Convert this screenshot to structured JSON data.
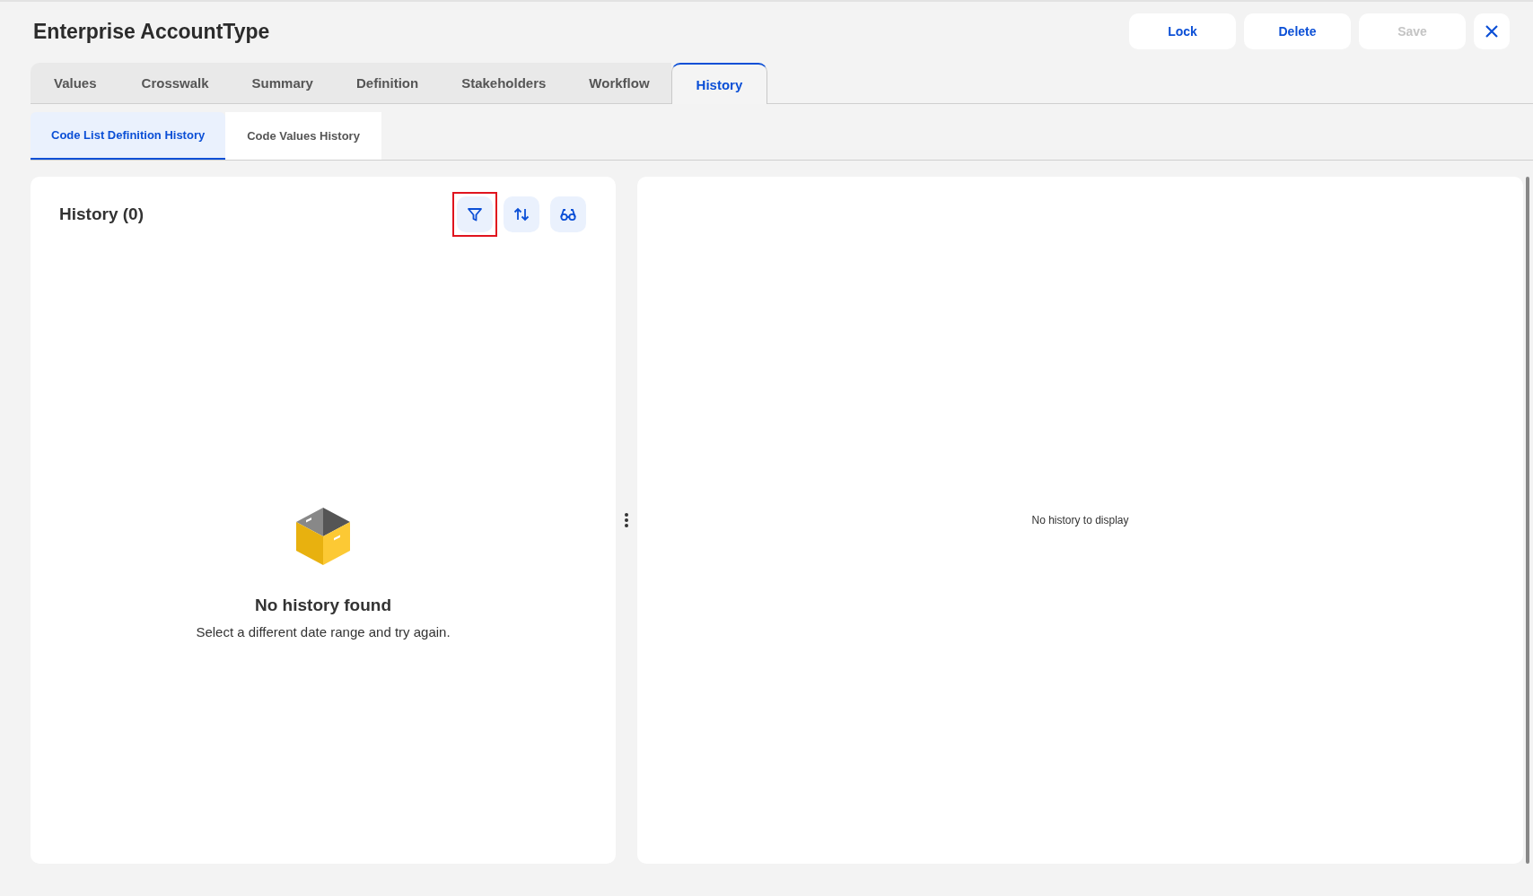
{
  "title": "Enterprise AccountType",
  "actions": [
    {
      "label": "Lock",
      "disabled": false
    },
    {
      "label": "Delete",
      "disabled": false
    },
    {
      "label": "Save",
      "disabled": true
    }
  ],
  "tabs": [
    {
      "label": "Values",
      "selected": false
    },
    {
      "label": "Crosswalk",
      "selected": false
    },
    {
      "label": "Summary",
      "selected": false
    },
    {
      "label": "Definition",
      "selected": false
    },
    {
      "label": "Stakeholders",
      "selected": false
    },
    {
      "label": "Workflow",
      "selected": false
    },
    {
      "label": "History",
      "selected": true
    }
  ],
  "subtabs": [
    {
      "label": "Code List Definition History",
      "selected": true
    },
    {
      "label": "Code Values History",
      "selected": false
    }
  ],
  "history_panel": {
    "heading": "History (0)",
    "tools": [
      {
        "kind": "filter",
        "highlighted": true
      },
      {
        "kind": "sort",
        "highlighted": false
      },
      {
        "kind": "view",
        "highlighted": false
      }
    ],
    "empty_title": "No history found",
    "empty_text": "Select a different date range and try again."
  },
  "detail_panel": {
    "message": "No history to display"
  }
}
